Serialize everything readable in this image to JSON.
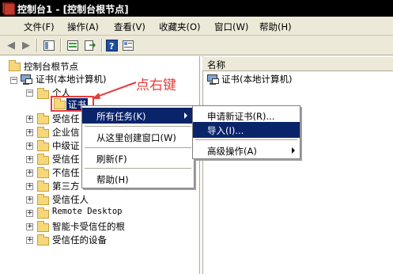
{
  "window": {
    "title": "控制台1 - [控制台根节点]"
  },
  "menu": {
    "items": [
      "文件(F)",
      "操作(A)",
      "查看(V)",
      "收藏夹(O)",
      "窗口(W)",
      "帮助(H)"
    ]
  },
  "toolbar": {
    "buttons": [
      "back-icon",
      "forward-icon",
      "up-icon",
      "show-hide-tree-icon",
      "export-icon",
      "help-icon",
      "properties-icon"
    ]
  },
  "tree": {
    "root_label": "控制台根节点",
    "cert_node_label": "证书(本地计算机)",
    "personal_label": "个人",
    "cert_label": "证书",
    "children": [
      {
        "label": "受信任"
      },
      {
        "label": "企业信"
      },
      {
        "label": "中级证"
      },
      {
        "label": "受信任"
      },
      {
        "label": "不信任"
      },
      {
        "label": "第三方"
      },
      {
        "label": "受信任人"
      },
      {
        "label": "Remote Desktop"
      },
      {
        "label": "智能卡受信任的根"
      },
      {
        "label": "受信任的设备"
      }
    ]
  },
  "right_pane": {
    "column_header": "名称",
    "item_label": "证书(本地计算机)"
  },
  "context_menu": {
    "items": [
      {
        "label": "所有任务(K)",
        "selected": true,
        "submenu": true
      },
      {
        "label": "从这里创建窗口(W)"
      },
      {
        "label": "刷新(F)"
      },
      {
        "label": "帮助(H)"
      }
    ]
  },
  "submenu": {
    "items": [
      {
        "label": "申请新证书(R)..."
      },
      {
        "label": "导入(I)...",
        "selected": true
      },
      {
        "label": "高级操作(A)",
        "submenu": true
      }
    ]
  },
  "annotation": {
    "text": "点右键",
    "color": "#e53e3e"
  },
  "colors": {
    "selection": "#0a246a",
    "chrome": "#ece9d8",
    "folder": "#f6d77a"
  }
}
